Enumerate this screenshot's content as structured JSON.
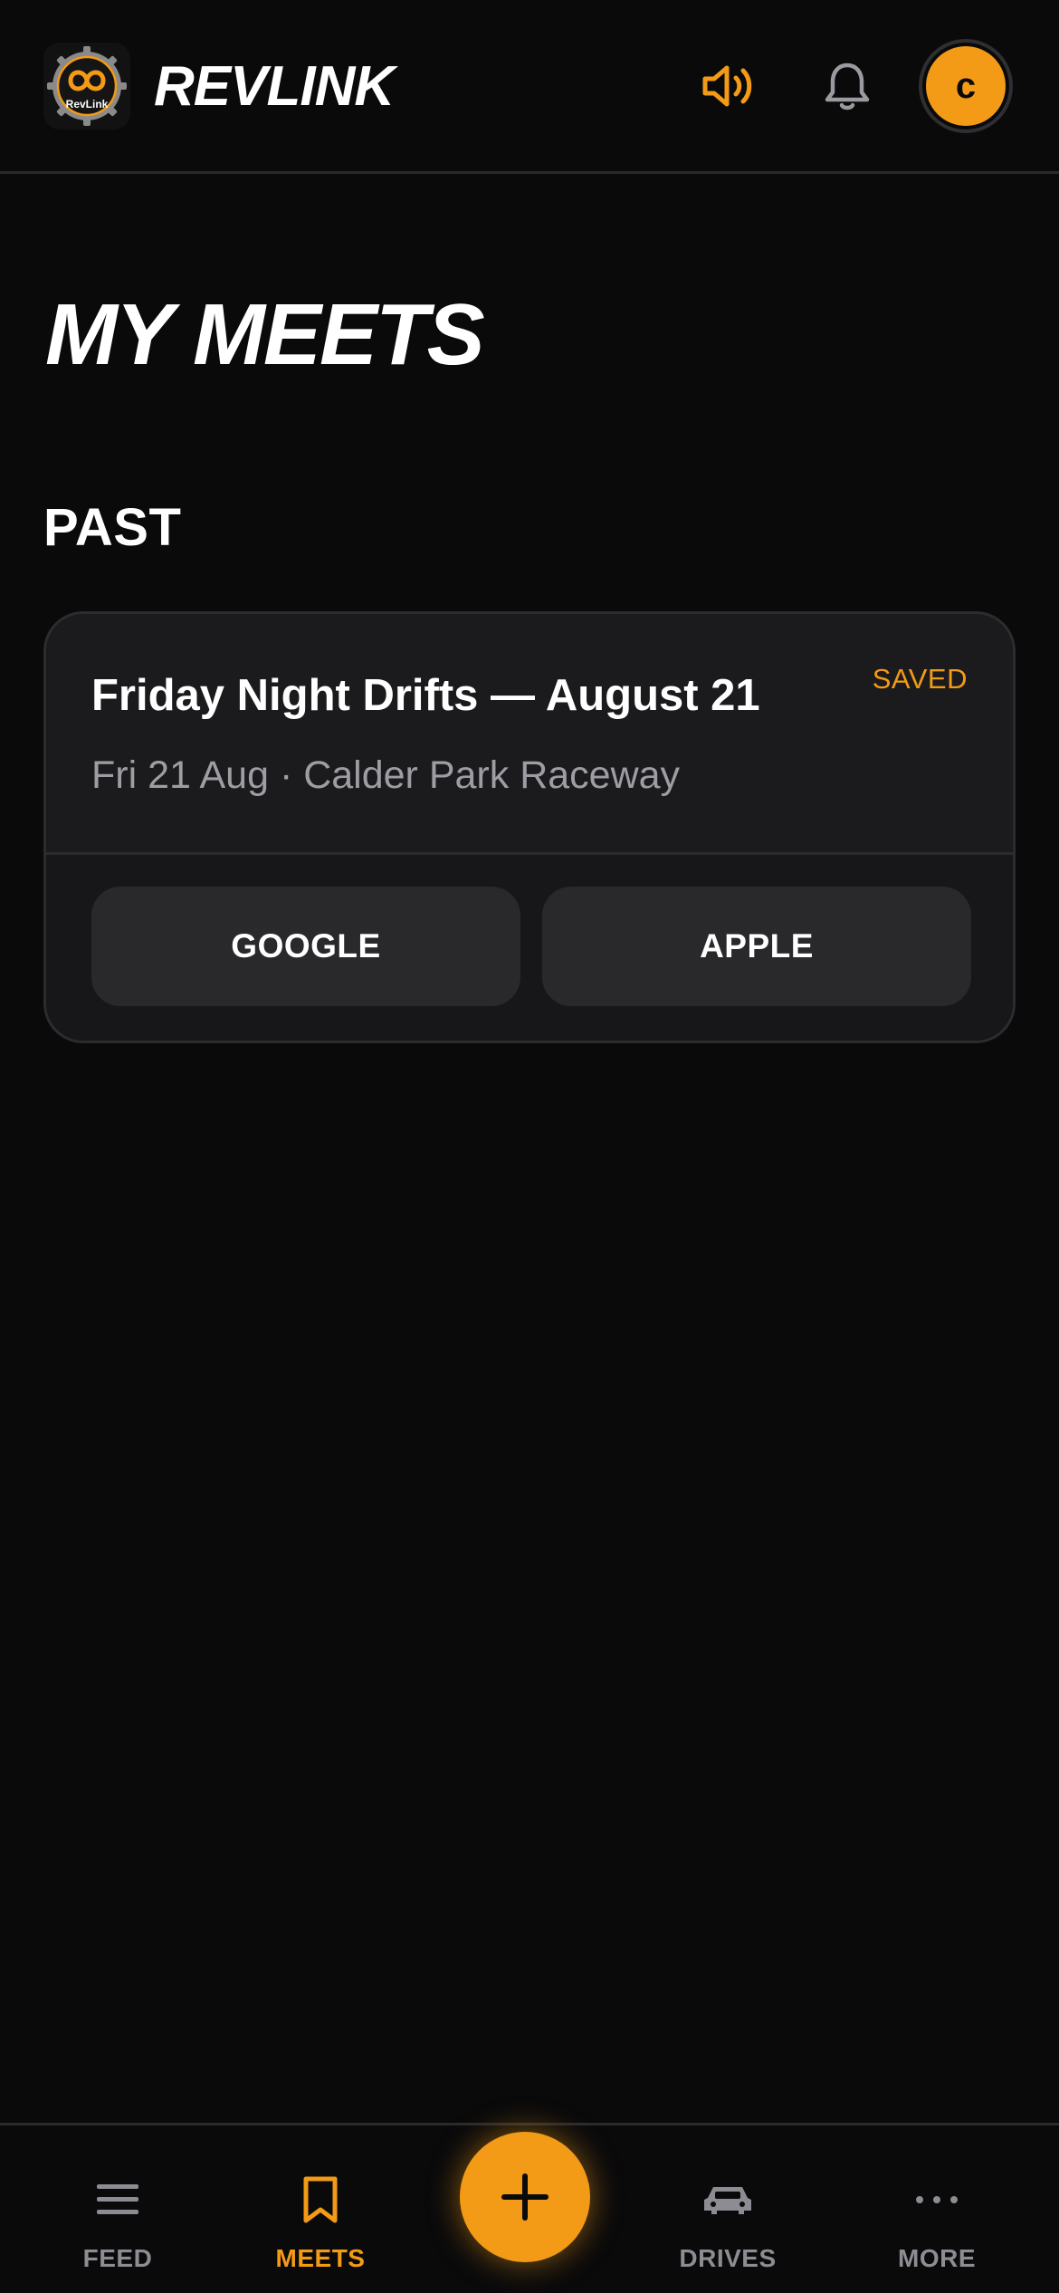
{
  "app": {
    "brand": "REVLINK",
    "logo_text": "RevLink",
    "accent_color": "#f39a16",
    "background_color": "#0a0a0b"
  },
  "header": {
    "sound_icon": "speaker-wave-icon",
    "bell_icon": "bell-icon",
    "avatar_initial": "c"
  },
  "page": {
    "title": "MY MEETS",
    "section": "PAST"
  },
  "meets": [
    {
      "title": "Friday Night Drifts — August 21",
      "status": "SAVED",
      "meta": "Fri 21 Aug · Calder Park Raceway",
      "actions": [
        "GOOGLE",
        "APPLE"
      ]
    }
  ],
  "nav": {
    "items": [
      {
        "label": "FEED",
        "icon": "menu-lines-icon",
        "active": false
      },
      {
        "label": "MEETS",
        "icon": "bookmark-icon",
        "active": true
      },
      {
        "label": "DRIVES",
        "icon": "car-icon",
        "active": false
      },
      {
        "label": "MORE",
        "icon": "ellipsis-icon",
        "active": false
      }
    ],
    "fab_icon": "plus-icon"
  }
}
